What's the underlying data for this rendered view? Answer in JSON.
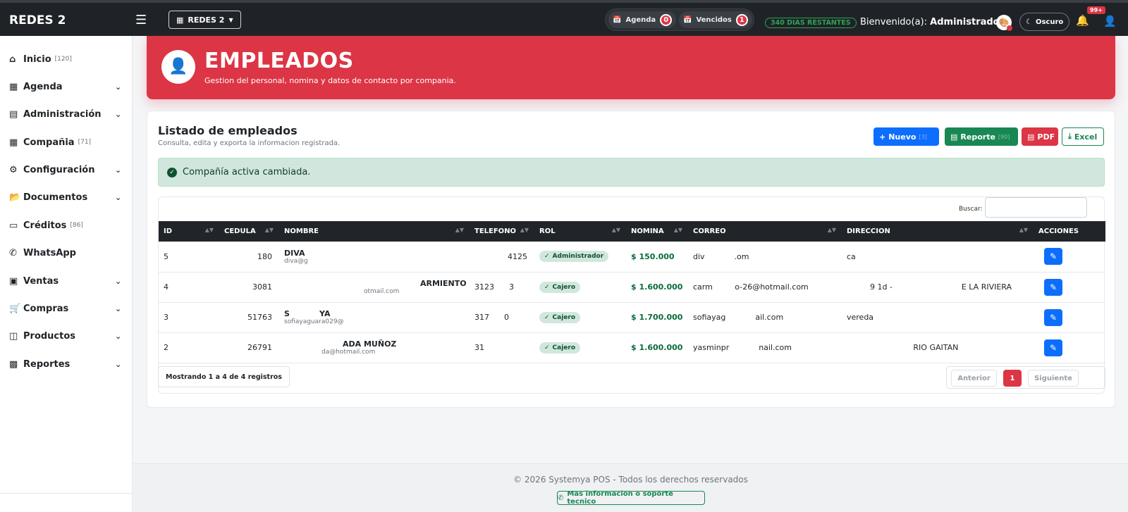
{
  "topbar": {
    "brand": "REDES 2",
    "menu_icon": "hamburger-icon",
    "company_select": "REDES 2",
    "agenda": {
      "label": "Agenda",
      "count": "0"
    },
    "vencidos": {
      "label": "Vencidos",
      "count": "1"
    },
    "days_remaining": "340 DIAS RESTANTES",
    "welcome_prefix": "Bienvenido(a):",
    "welcome_user": "Administrador",
    "theme_label": "Oscuro",
    "notifications_badge": "99+"
  },
  "sidebar": {
    "items": [
      {
        "label": "Inicio",
        "count": "[120]",
        "icon": "home-icon",
        "expandable": false
      },
      {
        "label": "Agenda",
        "count": "",
        "icon": "calendar-icon",
        "expandable": true
      },
      {
        "label": "Administración",
        "count": "",
        "icon": "id-card-icon",
        "expandable": true
      },
      {
        "label": "Compañia",
        "count": "[71]",
        "icon": "building-icon",
        "expandable": false
      },
      {
        "label": "Configuración",
        "count": "",
        "icon": "gears-icon",
        "expandable": true
      },
      {
        "label": "Documentos",
        "count": "",
        "icon": "folder-icon",
        "expandable": true
      },
      {
        "label": "Créditos",
        "count": "[86]",
        "icon": "credit-card-icon",
        "expandable": false
      },
      {
        "label": "WhatsApp",
        "count": "",
        "icon": "whatsapp-icon",
        "expandable": false
      },
      {
        "label": "Ventas",
        "count": "",
        "icon": "cash-register-icon",
        "expandable": true
      },
      {
        "label": "Compras",
        "count": "",
        "icon": "cart-icon",
        "expandable": true
      },
      {
        "label": "Productos",
        "count": "",
        "icon": "boxes-icon",
        "expandable": true
      },
      {
        "label": "Reportes",
        "count": "",
        "icon": "chart-icon",
        "expandable": true
      }
    ]
  },
  "header": {
    "title": "EMPLEADOS",
    "subtitle": "Gestion del personal, nomina y datos de contacto por compania."
  },
  "card": {
    "title": "Listado de empleados",
    "subtitle": "Consulta, edita y exporta la informacion registrada.",
    "buttons": {
      "new": "Nuevo",
      "new_hint": "[3]",
      "report": "Reporte",
      "report_hint": "[90]",
      "pdf": "PDF",
      "excel": "Excel"
    },
    "alert": "Compañía activa cambiada.",
    "search_label": "Buscar:",
    "search_value": ""
  },
  "table": {
    "columns": [
      "ID",
      "CEDULA",
      "NOMBRE",
      "TELEFONO",
      "ROL",
      "NOMINA",
      "CORREO",
      "DIRECCION",
      "ACCIONES"
    ],
    "rows": [
      {
        "id": "5",
        "cedula": "180",
        "name": "DIVA",
        "name_sub": "diva@g",
        "telefono": "4125",
        "rol": "Administrador",
        "nomina": "$ 150.000",
        "correo": "div            .om",
        "direccion": "ca"
      },
      {
        "id": "4",
        "cedula": "3081",
        "name": "ARMIENTO",
        "name_sub": "otmail.com",
        "telefono": "3123      3",
        "rol": "Cajero",
        "nomina": "$ 1.600.000",
        "correo": "carm         o-26@hotmail.com",
        "direccion": "9 1d -                            E LA RIVIERA"
      },
      {
        "id": "3",
        "cedula": "51763",
        "name": "S           YA",
        "name_sub": "sofiayaguara029@",
        "telefono": "317      0",
        "rol": "Cajero",
        "nomina": "$ 1.700.000",
        "correo": "sofiayag            ail.com",
        "direccion": "vereda"
      },
      {
        "id": "2",
        "cedula": "26791",
        "name": "ADA MUÑOZ",
        "name_sub": "da@hotmail.com",
        "telefono": "31",
        "rol": "Cajero",
        "nomina": "$ 1.600.000",
        "correo": "yasminpr            nail.com",
        "direccion": "                           RIO GAITAN"
      }
    ],
    "info": "Mostrando 1 a 4 de 4 registros",
    "pagination": {
      "prev": "Anterior",
      "current": "1",
      "next": "Siguiente"
    }
  },
  "footer": {
    "copyright": "© 2026 Systemya POS - Todos los derechos reservados",
    "support": "Mas informacion o soporte tecnico"
  },
  "colors": {
    "primary": "#0d6efd",
    "danger": "#dc3545",
    "success": "#198754",
    "dark": "#212529"
  }
}
